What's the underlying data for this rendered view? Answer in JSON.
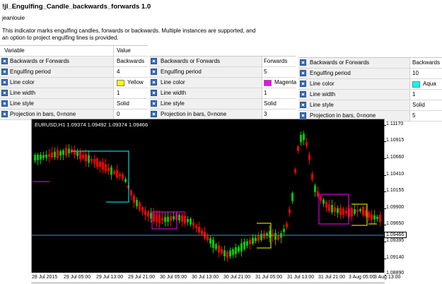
{
  "header": {
    "title": "!jl_Engulfing_Candle_backwards_forwards 1.0",
    "author": "jeanlouie",
    "description": "This indicator marks engulfing candles, forwards or backwards. Multiple instances are supported, and an option to project engulfing lines is provided."
  },
  "table1": {
    "col_variable": "Variable",
    "col_value": "Value",
    "rows": [
      {
        "label": "Backwards or Forwards",
        "value": "Backwards"
      },
      {
        "label": "Engulfing period",
        "value": "4"
      },
      {
        "label": "Line color",
        "value": "Yellow",
        "swatch": "#ffff00"
      },
      {
        "label": "Line width",
        "value": "1"
      },
      {
        "label": "Line style",
        "value": "Solid"
      },
      {
        "label": "Projection in bars, 0=none",
        "value": "0"
      }
    ]
  },
  "table2": {
    "rows": [
      {
        "label": "Backwards or Forwards",
        "value": "Forwards"
      },
      {
        "label": "Engulfing period",
        "value": "5"
      },
      {
        "label": "Line color",
        "value": "Magenta",
        "swatch": "#ff00ff"
      },
      {
        "label": "Line width",
        "value": "1"
      },
      {
        "label": "Line style",
        "value": "Solid"
      },
      {
        "label": "Projection in bars, 0=none",
        "value": "3"
      }
    ]
  },
  "table3": {
    "rows": [
      {
        "label": "Backwards or Forwards",
        "value": "Backwards"
      },
      {
        "label": "Engulfing period",
        "value": "10"
      },
      {
        "label": "Line color",
        "value": "Aqua",
        "swatch": "#00ffff"
      },
      {
        "label": "Line width",
        "value": "1"
      },
      {
        "label": "Line style",
        "value": "Solid"
      },
      {
        "label": "Projection in bars, 0=none",
        "value": "5"
      }
    ]
  },
  "chart": {
    "symbol_line": "EURUSD,H1  1.09374 1.09492 1.09374 1.09466",
    "current_price": "1.09466",
    "y_labels": [
      "1.11170",
      "1.10915",
      "1.10660",
      "1.10410",
      "1.10155",
      "1.09900",
      "1.09650",
      "1.09395",
      "1.09140",
      "1.08890"
    ],
    "x_labels": [
      "28 Jul 2015",
      "29 Jul 05:00",
      "29 Jul 13:00",
      "29 Jul 21:00",
      "30 Jul 05:00",
      "30 Jul 13:00",
      "30 Jul 21:00",
      "31 Jul 05:00",
      "31 Jul 13:00",
      "31 Jul 21:00",
      "3 Aug 05:00",
      "3 Aug 13:00"
    ],
    "colors": {
      "background": "#000000",
      "bull": "#00c800",
      "bear": "#ff0000",
      "price_line": "#4a90c0",
      "yellow": "#ffff00",
      "magenta": "#ff00ff",
      "aqua": "#00ffff"
    }
  }
}
